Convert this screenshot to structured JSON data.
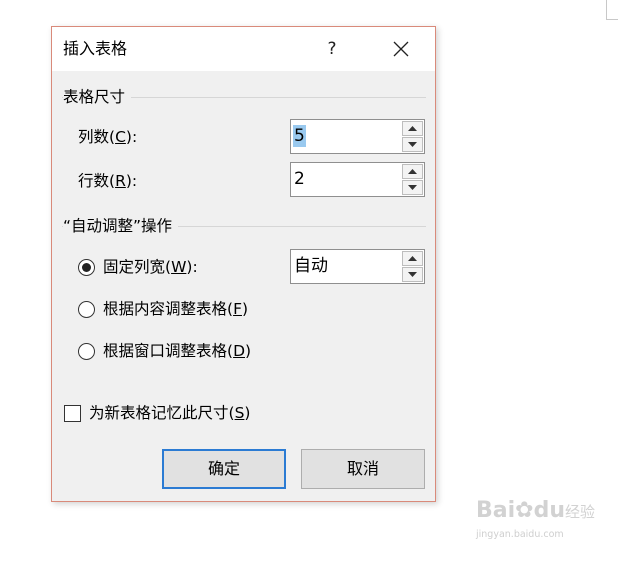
{
  "dialog": {
    "title": "插入表格",
    "help_label": "?"
  },
  "table_size": {
    "group_label": "表格尺寸",
    "columns": {
      "label_pre": "列数(",
      "mnemonic": "C",
      "label_post": "):",
      "value": "5"
    },
    "rows": {
      "label_pre": "行数(",
      "mnemonic": "R",
      "label_post": "):",
      "value": "2"
    }
  },
  "autofit": {
    "group_label": "“自动调整”操作",
    "fixed": {
      "label_pre": "固定列宽(",
      "mnemonic": "W",
      "label_post": "):",
      "value": "自动",
      "selected": true
    },
    "content": {
      "label_pre": "根据内容调整表格(",
      "mnemonic": "F",
      "label_post": ")",
      "selected": false
    },
    "window": {
      "label_pre": "根据窗口调整表格(",
      "mnemonic": "D",
      "label_post": ")",
      "selected": false
    }
  },
  "remember": {
    "label_pre": "为新表格记忆此尺寸(",
    "mnemonic": "S",
    "label_post": ")",
    "checked": false
  },
  "buttons": {
    "ok": "确定",
    "cancel": "取消"
  },
  "watermark": {
    "logo_a": "Bai",
    "logo_b": "du",
    "logo_cn": "经验",
    "url": "jingyan.baidu.com"
  },
  "colors": {
    "dialog_border": "#d98a7a",
    "default_button_border": "#2b7bd3",
    "selection": "#99c9ef"
  }
}
